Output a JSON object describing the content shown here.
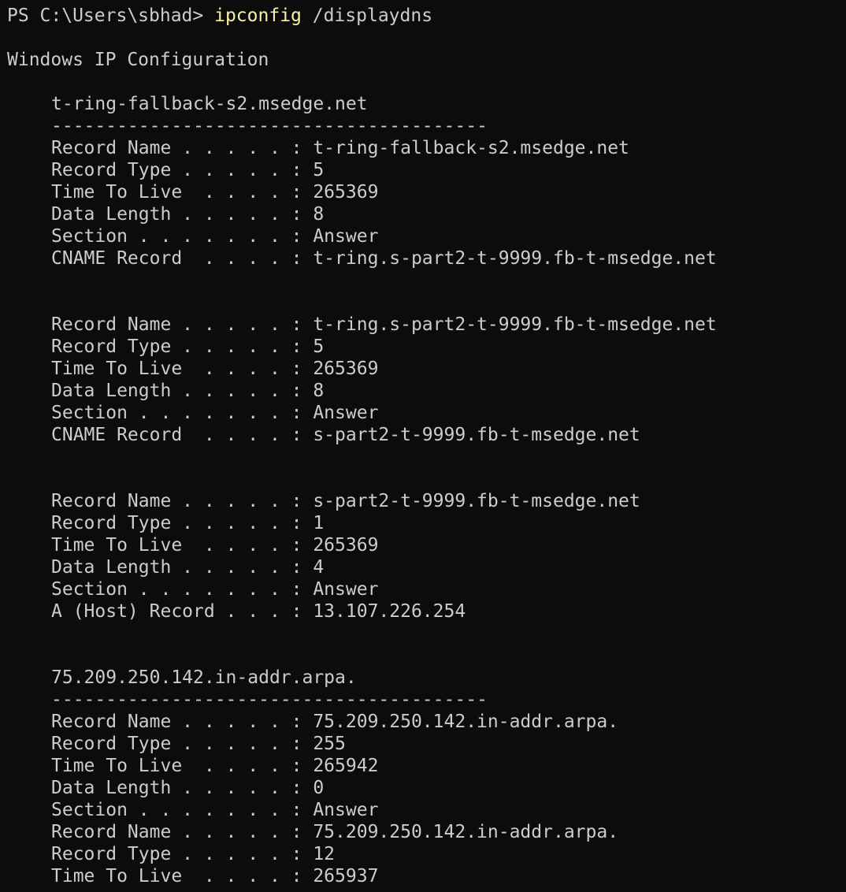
{
  "prompt": {
    "path": "PS C:\\Users\\sbhad> ",
    "command": "ipconfig",
    "args": " /displaydns"
  },
  "colors": {
    "background": "#0c0c0c",
    "text": "#cccccc",
    "command": "#f9f1a5"
  },
  "lines": [
    {
      "type": "blank"
    },
    {
      "type": "text",
      "text": "Windows IP Configuration"
    },
    {
      "type": "blank"
    },
    {
      "type": "entry",
      "text": "t-ring-fallback-s2.msedge.net"
    },
    {
      "type": "entry",
      "text": "----------------------------------------"
    },
    {
      "type": "entry",
      "text": "Record Name . . . . . : t-ring-fallback-s2.msedge.net"
    },
    {
      "type": "entry",
      "text": "Record Type . . . . . : 5"
    },
    {
      "type": "entry",
      "text": "Time To Live  . . . . : 265369"
    },
    {
      "type": "entry",
      "text": "Data Length . . . . . : 8"
    },
    {
      "type": "entry",
      "text": "Section . . . . . . . : Answer"
    },
    {
      "type": "entry",
      "text": "CNAME Record  . . . . : t-ring.s-part2-t-9999.fb-t-msedge.net"
    },
    {
      "type": "blank"
    },
    {
      "type": "blank"
    },
    {
      "type": "entry",
      "text": "Record Name . . . . . : t-ring.s-part2-t-9999.fb-t-msedge.net"
    },
    {
      "type": "entry",
      "text": "Record Type . . . . . : 5"
    },
    {
      "type": "entry",
      "text": "Time To Live  . . . . : 265369"
    },
    {
      "type": "entry",
      "text": "Data Length . . . . . : 8"
    },
    {
      "type": "entry",
      "text": "Section . . . . . . . : Answer"
    },
    {
      "type": "entry",
      "text": "CNAME Record  . . . . : s-part2-t-9999.fb-t-msedge.net"
    },
    {
      "type": "blank"
    },
    {
      "type": "blank"
    },
    {
      "type": "entry",
      "text": "Record Name . . . . . : s-part2-t-9999.fb-t-msedge.net"
    },
    {
      "type": "entry",
      "text": "Record Type . . . . . : 1"
    },
    {
      "type": "entry",
      "text": "Time To Live  . . . . : 265369"
    },
    {
      "type": "entry",
      "text": "Data Length . . . . . : 4"
    },
    {
      "type": "entry",
      "text": "Section . . . . . . . : Answer"
    },
    {
      "type": "entry",
      "text": "A (Host) Record . . . : 13.107.226.254"
    },
    {
      "type": "blank"
    },
    {
      "type": "blank"
    },
    {
      "type": "entry",
      "text": "75.209.250.142.in-addr.arpa."
    },
    {
      "type": "entry",
      "text": "----------------------------------------"
    },
    {
      "type": "entry",
      "text": "Record Name . . . . . : 75.209.250.142.in-addr.arpa."
    },
    {
      "type": "entry",
      "text": "Record Type . . . . . : 255"
    },
    {
      "type": "entry",
      "text": "Time To Live  . . . . : 265942"
    },
    {
      "type": "entry",
      "text": "Data Length . . . . . : 0"
    },
    {
      "type": "entry",
      "text": "Section . . . . . . . : Answer"
    },
    {
      "type": "entry",
      "text": "Record Name . . . . . : 75.209.250.142.in-addr.arpa."
    },
    {
      "type": "entry",
      "text": "Record Type . . . . . : 12"
    },
    {
      "type": "entry",
      "text": "Time To Live  . . . . : 265937"
    }
  ]
}
